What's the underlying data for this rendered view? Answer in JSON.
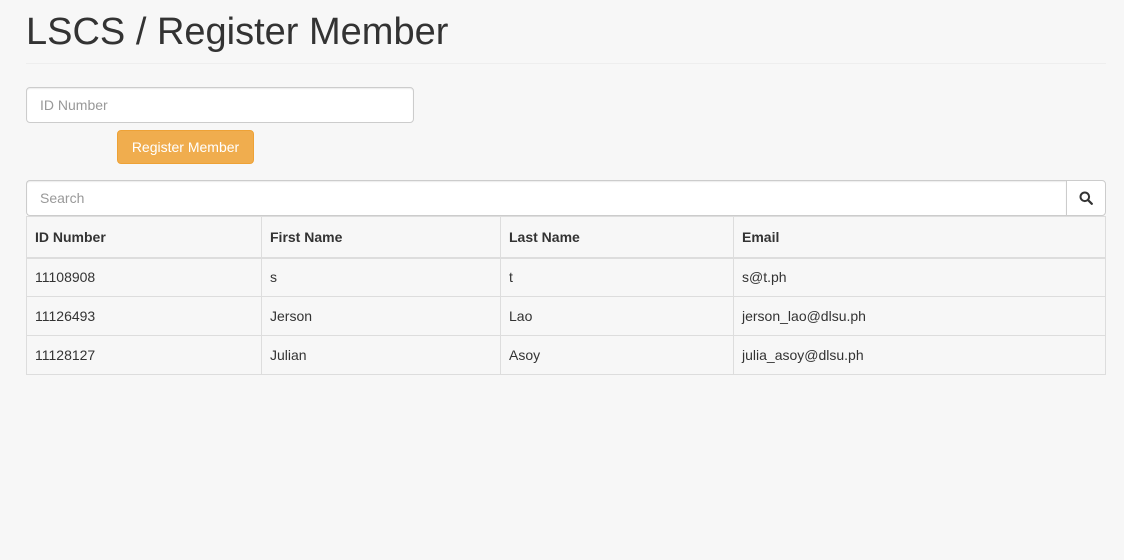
{
  "header": {
    "title": "LSCS / Register Member"
  },
  "register_form": {
    "id_placeholder": "ID Number",
    "id_value": "",
    "register_label": "Register Member",
    "button_color": "#f0ad4e"
  },
  "search": {
    "placeholder": "Search",
    "value": "",
    "button_icon": "search-icon"
  },
  "table": {
    "columns": [
      "ID Number",
      "First Name",
      "Last Name",
      "Email"
    ],
    "rows": [
      [
        "11108908",
        "s",
        "t",
        "s@t.ph"
      ],
      [
        "11126493",
        "Jerson",
        "Lao",
        "jerson_lao@dlsu.ph"
      ],
      [
        "11128127",
        "Julian",
        "Asoy",
        "julia_asoy@dlsu.ph"
      ]
    ]
  }
}
